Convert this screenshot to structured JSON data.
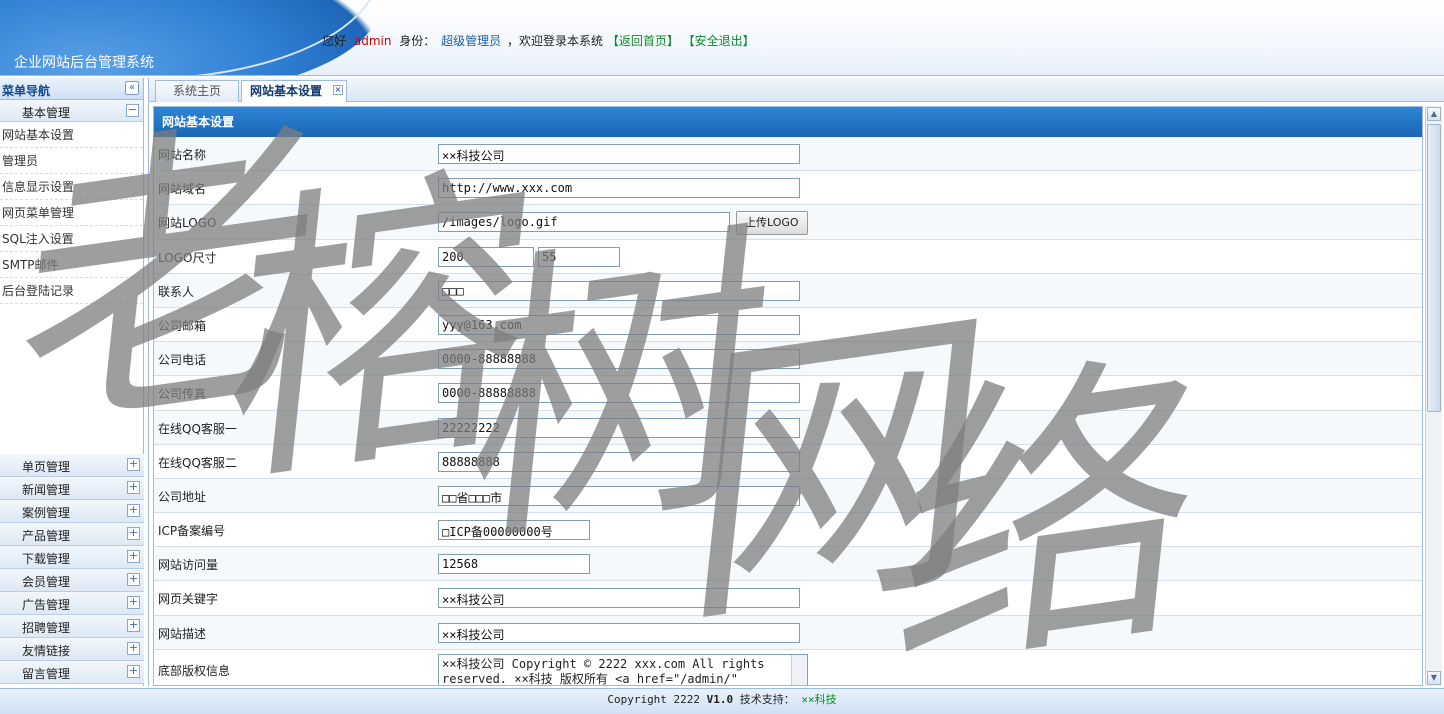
{
  "header": {
    "system_title": "企业网站后台管理系统",
    "greeting": "您好",
    "username": "admin",
    "role_label": "身份：",
    "role": "超级管理员",
    "welcome_text": "，欢迎登录本系统",
    "home_link": "【返回首页】",
    "logout_link": "【安全退出】"
  },
  "sidebar": {
    "title": "菜单导航",
    "basic_group": "基本管理",
    "basic_items": [
      "网站基本设置",
      "管理员",
      "信息显示设置",
      "网页菜单管理",
      "SQL注入设置",
      "SMTP邮件",
      "后台登陆记录"
    ],
    "groups": [
      "单页管理",
      "新闻管理",
      "案例管理",
      "产品管理",
      "下载管理",
      "会员管理",
      "广告管理",
      "招聘管理",
      "友情链接",
      "留言管理"
    ]
  },
  "tabs": [
    {
      "label": "系统主页"
    },
    {
      "label": "网站基本设置"
    }
  ],
  "panel": {
    "title": "网站基本设置",
    "upload_button": "上传LOGO",
    "fields": {
      "site_name": {
        "label": "网站名称",
        "value": "××科技公司"
      },
      "domain": {
        "label": "网站域名",
        "value": "http://www.xxx.com"
      },
      "logo": {
        "label": "网站LOGO",
        "value": "/images/logo.gif"
      },
      "logo_size": {
        "label": "LOGO尺寸",
        "width": "200",
        "height": "55"
      },
      "contact": {
        "label": "联系人",
        "value": "□□□"
      },
      "email": {
        "label": "公司邮箱",
        "value": "yyy@163.com"
      },
      "phone": {
        "label": "公司电话",
        "value": "0000-88888888"
      },
      "fax": {
        "label": "公司传真",
        "value": "0000-88888888"
      },
      "qq1": {
        "label": "在线QQ客服一",
        "value": "22222222"
      },
      "qq2": {
        "label": "在线QQ客服二",
        "value": "88888888"
      },
      "address": {
        "label": "公司地址",
        "value": "□□省□□□市"
      },
      "icp": {
        "label": "ICP备案编号",
        "value": "□ICP备00000000号"
      },
      "visits": {
        "label": "网站访问量",
        "value": "12568"
      },
      "keywords": {
        "label": "网页关键字",
        "value": "××科技公司"
      },
      "description": {
        "label": "网站描述",
        "value": "××科技公司"
      },
      "copyright": {
        "label": "底部版权信息",
        "value": "××科技公司 Copyright © 2222 xxx.com All rights reserved. ××科技 版权所有 <a href=\"/admin/\""
      }
    }
  },
  "footer": {
    "copyright": "Copyright 2222 ",
    "version": "V1.0",
    "support_label": " 技术支持： ",
    "support": "××科技"
  },
  "watermark": {
    "chars": [
      "老",
      "榕",
      "树",
      "网",
      "络"
    ]
  }
}
